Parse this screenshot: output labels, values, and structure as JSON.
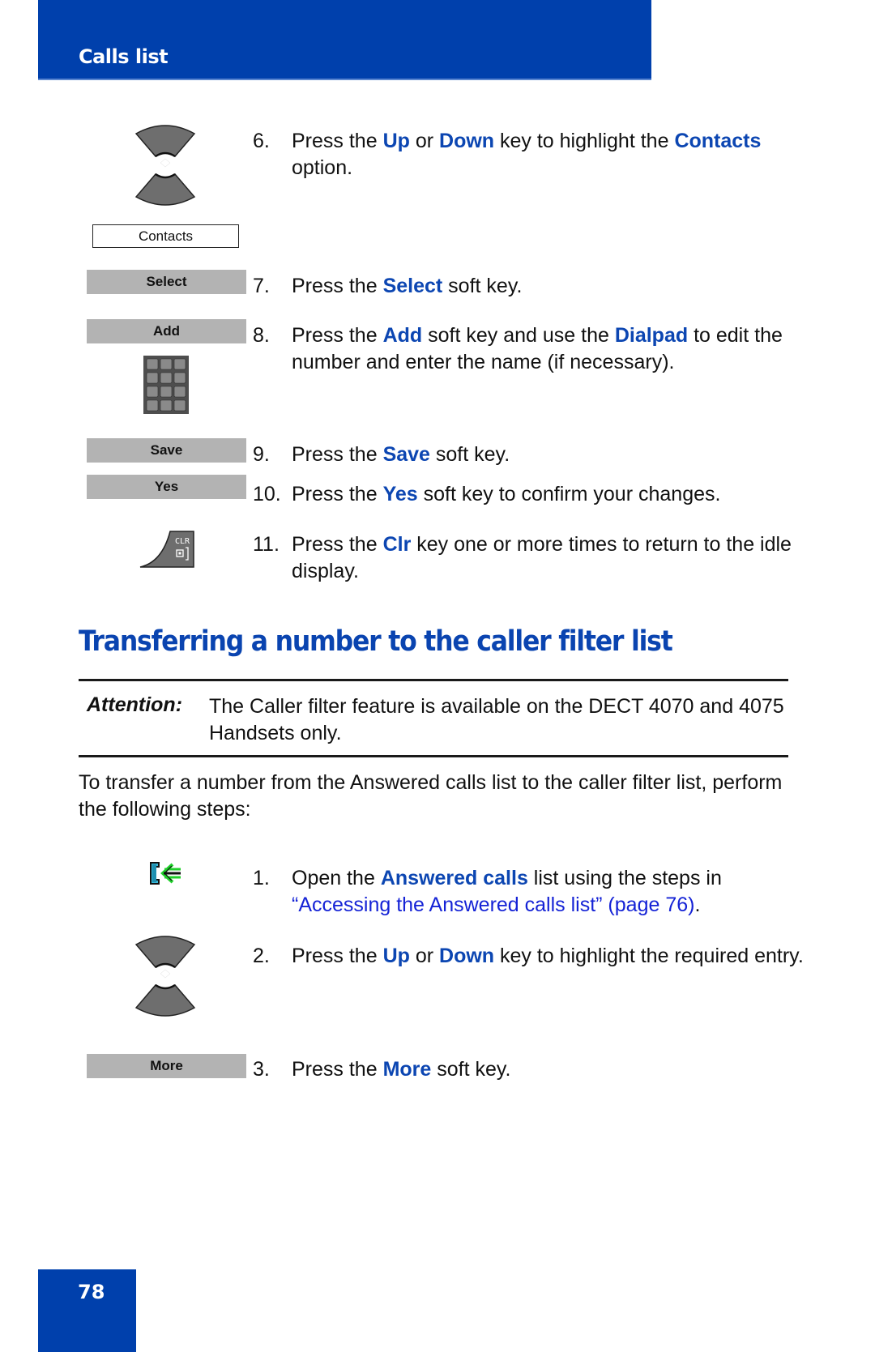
{
  "header": {
    "title": "Calls list"
  },
  "footer": {
    "page_number": "78"
  },
  "icons": {
    "nav_up_down": "navigation-up-down-key-icon",
    "dialpad": "dialpad-icon",
    "clr": "clr-key-icon",
    "clr_label": "CLR",
    "answered_calls": "answered-calls-icon"
  },
  "colors": {
    "brand_blue": "#0040ac",
    "keyword_blue": "#0c46b2",
    "link_blue": "#1523d6",
    "softkey_gray": "#b3b3b3"
  },
  "section1": {
    "contacts_option": "Contacts",
    "softkeys": {
      "select": "Select",
      "add": "Add",
      "save": "Save",
      "yes": "Yes"
    },
    "steps": [
      {
        "num": "6.",
        "parts": [
          {
            "t": "Press the "
          },
          {
            "t": "Up",
            "k": 1
          },
          {
            "t": " or "
          },
          {
            "t": "Down",
            "k": 1
          },
          {
            "t": " key to highlight the "
          },
          {
            "t": "Contacts",
            "k": 1
          },
          {
            "t": " option."
          }
        ]
      },
      {
        "num": "7.",
        "parts": [
          {
            "t": "Press the "
          },
          {
            "t": "Select",
            "k": 1
          },
          {
            "t": " soft key."
          }
        ]
      },
      {
        "num": "8.",
        "parts": [
          {
            "t": "Press the "
          },
          {
            "t": "Add",
            "k": 1
          },
          {
            "t": " soft key and use the "
          },
          {
            "t": "Dialpad",
            "k": 1
          },
          {
            "t": " to edit the number and enter the name (if necessary)."
          }
        ]
      },
      {
        "num": "9.",
        "parts": [
          {
            "t": "Press the "
          },
          {
            "t": "Save",
            "k": 1
          },
          {
            "t": " soft key."
          }
        ]
      },
      {
        "num": "10.",
        "parts": [
          {
            "t": "Press the "
          },
          {
            "t": "Yes",
            "k": 1
          },
          {
            "t": " soft key to confirm your changes."
          }
        ]
      },
      {
        "num": "11.",
        "parts": [
          {
            "t": "Press the "
          },
          {
            "t": "Clr",
            "k": 1
          },
          {
            "t": " key one or more times to return to the idle display."
          }
        ]
      }
    ]
  },
  "section2": {
    "heading": "Transferring a number to the caller filter list",
    "attention_label": "Attention:",
    "attention_text": "The Caller filter feature is available on the DECT 4070 and 4075 Handsets only.",
    "intro": "To transfer a number from the Answered calls list to the caller filter list, perform the following steps:",
    "softkeys": {
      "more": "More"
    },
    "steps": [
      {
        "num": "1.",
        "parts": [
          {
            "t": "Open the "
          },
          {
            "t": "Answered calls",
            "k": 1
          },
          {
            "t": " list using the steps in "
          },
          {
            "t": "“Accessing the Answered calls list” (page 76)",
            "l": 1
          },
          {
            "t": "."
          }
        ]
      },
      {
        "num": "2.",
        "parts": [
          {
            "t": "Press the "
          },
          {
            "t": "Up",
            "k": 1
          },
          {
            "t": " or "
          },
          {
            "t": "Down",
            "k": 1
          },
          {
            "t": " key to highlight the required entry."
          }
        ]
      },
      {
        "num": "3.",
        "parts": [
          {
            "t": "Press the "
          },
          {
            "t": "More",
            "k": 1
          },
          {
            "t": " soft key."
          }
        ]
      }
    ]
  }
}
